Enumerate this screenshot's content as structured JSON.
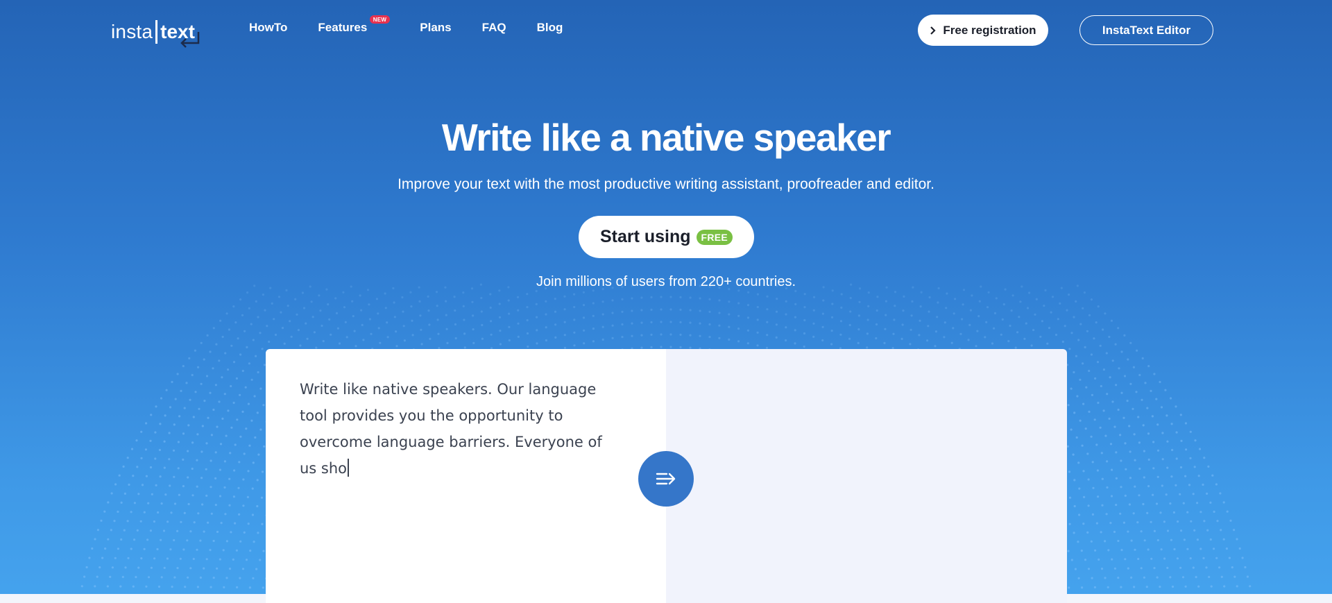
{
  "logo": {
    "part1": "insta",
    "part2": "text"
  },
  "nav": {
    "items": [
      {
        "label": "HowTo"
      },
      {
        "label": "Features",
        "badge": "NEW"
      },
      {
        "label": "Plans"
      },
      {
        "label": "FAQ"
      },
      {
        "label": "Blog"
      }
    ],
    "register_label": "Free registration",
    "editor_label": "InstaText Editor"
  },
  "hero": {
    "title": "Write like a native speaker",
    "subtitle": "Improve your text with the most productive writing assistant, proofreader and editor.",
    "cta_label": "Start using",
    "cta_badge": "FREE",
    "join_text": "Join millions of users from 220+ countries."
  },
  "editor": {
    "input_text": "Write like native speakers. Our language tool provides you the opportunity to overcome language barriers. Everyone of us sho",
    "output_text": ""
  },
  "icons": {
    "logo_enter": "enter-arrow-icon",
    "register": "chevron-right-icon",
    "convert": "improve-text-arrow-icon"
  },
  "colors": {
    "background_top": "#2464b6",
    "background_bottom": "#45a3ee",
    "badge_new": "#e8324f",
    "badge_free": "#7ac043",
    "convert_button": "#3576c9",
    "output_panel": "#f1f3fc"
  }
}
